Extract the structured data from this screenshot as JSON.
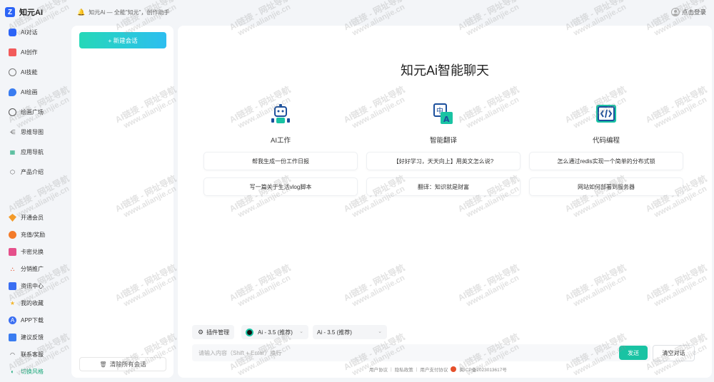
{
  "header": {
    "app_title": "知元AI",
    "logo_letter": "Z",
    "slogan": "知元Ai — 全能\"知元\"，创作助手",
    "login_label": "点击登录"
  },
  "nav": {
    "items": [
      {
        "label": "AI对话",
        "icon": "chat-icon"
      },
      {
        "label": "AI创作",
        "icon": "create-icon"
      },
      {
        "label": "AI技能",
        "icon": "skill-icon"
      },
      {
        "label": "AI绘画",
        "icon": "paint-icon"
      },
      {
        "label": "绘画广场",
        "icon": "gallery-icon"
      },
      {
        "label": "思维导图",
        "icon": "mindmap-icon"
      },
      {
        "label": "应用导航",
        "icon": "app-grid-icon"
      },
      {
        "label": "产品介绍",
        "icon": "cube-icon"
      }
    ],
    "bottom_items": [
      {
        "label": "开通会员",
        "icon": "vip-icon"
      },
      {
        "label": "充值/奖励",
        "icon": "recharge-icon"
      },
      {
        "label": "卡密兑换",
        "icon": "card-icon"
      },
      {
        "label": "分销推广",
        "icon": "share-icon"
      },
      {
        "label": "资讯中心",
        "icon": "news-icon"
      },
      {
        "label": "我的收藏",
        "icon": "star-icon"
      },
      {
        "label": "APP下载",
        "icon": "app-download-icon"
      },
      {
        "label": "建议反馈",
        "icon": "feedback-icon"
      },
      {
        "label": "联系客服",
        "icon": "headset-icon"
      },
      {
        "label": "切换风格",
        "icon": "theme-icon"
      }
    ]
  },
  "sessions": {
    "new_chat_label": "+ 新建会话",
    "clear_all_label": "清除所有会话"
  },
  "main": {
    "title": "知元Ai智能聊天",
    "features": [
      {
        "label": "AI工作",
        "icon": "robot-icon"
      },
      {
        "label": "智能翻译",
        "icon": "translate-icon"
      },
      {
        "label": "代码编程",
        "icon": "code-icon"
      }
    ],
    "suggestions": [
      "帮我生成一份工作日报",
      "【好好学习，天天向上】用英文怎么说?",
      "怎么通过redis实现一个简单的分布式锁",
      "写一篇关于生活vlog脚本",
      "翻译：知识就是财富",
      "网站如何部署到服务器"
    ],
    "plugin_label": "插件管理",
    "model_primary": "Ai - 3.5 (推荐)",
    "model_secondary": "Ai - 3.5 (推荐)",
    "input_placeholder": "请输入内容（Shift + Enter）换行",
    "send_label": "发送",
    "clear_chat_label": "清空对话"
  },
  "footer": {
    "user_agreement": "用户协议",
    "privacy": "隐私政策",
    "payment": "用户支付协议",
    "beian": "闽ICP备2023013617号"
  },
  "watermark": {
    "line1": "AI链接 - 网址导航",
    "line2": "www.alianjie.cn"
  },
  "colors": {
    "accent": "#19c3a3",
    "brand_blue": "#2c64f6",
    "background": "#f3f5f8"
  }
}
